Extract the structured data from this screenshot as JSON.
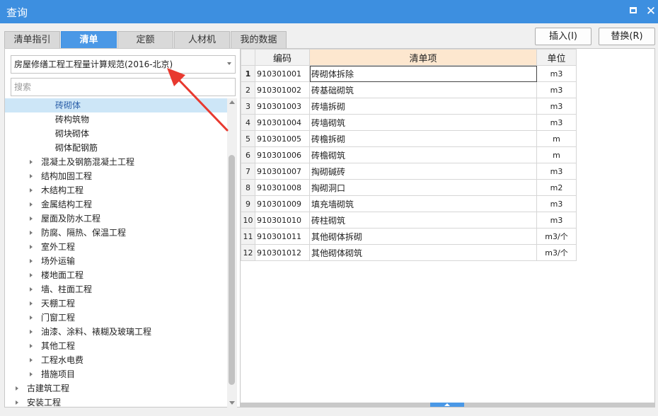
{
  "window": {
    "title": "查询"
  },
  "tabs": [
    {
      "label": "清单指引",
      "active": false
    },
    {
      "label": "清单",
      "active": true
    },
    {
      "label": "定额",
      "active": false
    },
    {
      "label": "人材机",
      "active": false
    },
    {
      "label": "我的数据",
      "active": false
    }
  ],
  "toolbar": {
    "insert_label": "插入(I)",
    "replace_label": "替换(R)"
  },
  "left": {
    "standard_selected": "房屋修缮工程工程量计算规范(2016-北京)",
    "search_placeholder": "搜索",
    "tree": [
      {
        "label": "砖砌体",
        "level": 3,
        "selected": true,
        "expandable": false
      },
      {
        "label": "砖构筑物",
        "level": 3,
        "selected": false,
        "expandable": false
      },
      {
        "label": "砌块砌体",
        "level": 3,
        "selected": false,
        "expandable": false
      },
      {
        "label": "砌体配钢筋",
        "level": 3,
        "selected": false,
        "expandable": false
      },
      {
        "label": "混凝土及钢筋混凝土工程",
        "level": 2,
        "selected": false,
        "expandable": true
      },
      {
        "label": "结构加固工程",
        "level": 2,
        "selected": false,
        "expandable": true
      },
      {
        "label": "木结构工程",
        "level": 2,
        "selected": false,
        "expandable": true
      },
      {
        "label": "金属结构工程",
        "level": 2,
        "selected": false,
        "expandable": true
      },
      {
        "label": "屋面及防水工程",
        "level": 2,
        "selected": false,
        "expandable": true
      },
      {
        "label": "防腐、隔热、保温工程",
        "level": 2,
        "selected": false,
        "expandable": true
      },
      {
        "label": "室外工程",
        "level": 2,
        "selected": false,
        "expandable": true
      },
      {
        "label": "场外运输",
        "level": 2,
        "selected": false,
        "expandable": true
      },
      {
        "label": "楼地面工程",
        "level": 2,
        "selected": false,
        "expandable": true
      },
      {
        "label": "墙、柱面工程",
        "level": 2,
        "selected": false,
        "expandable": true
      },
      {
        "label": "天棚工程",
        "level": 2,
        "selected": false,
        "expandable": true
      },
      {
        "label": "门窗工程",
        "level": 2,
        "selected": false,
        "expandable": true
      },
      {
        "label": "油漆、涂料、裱糊及玻璃工程",
        "level": 2,
        "selected": false,
        "expandable": true
      },
      {
        "label": "其他工程",
        "level": 2,
        "selected": false,
        "expandable": true
      },
      {
        "label": "工程水电费",
        "level": 2,
        "selected": false,
        "expandable": true
      },
      {
        "label": "措施项目",
        "level": 2,
        "selected": false,
        "expandable": true
      },
      {
        "label": "古建筑工程",
        "level": 1,
        "selected": false,
        "expandable": true
      },
      {
        "label": "安装工程",
        "level": 1,
        "selected": false,
        "expandable": true
      }
    ]
  },
  "table": {
    "columns": {
      "code": "编码",
      "name": "清单项",
      "unit": "单位"
    },
    "rows": [
      {
        "no": "1",
        "code": "910301001",
        "name": "砖砌体拆除",
        "unit": "m3",
        "active": true
      },
      {
        "no": "2",
        "code": "910301002",
        "name": "砖基础砌筑",
        "unit": "m3",
        "active": false
      },
      {
        "no": "3",
        "code": "910301003",
        "name": "砖墙拆砌",
        "unit": "m3",
        "active": false
      },
      {
        "no": "4",
        "code": "910301004",
        "name": "砖墙砌筑",
        "unit": "m3",
        "active": false
      },
      {
        "no": "5",
        "code": "910301005",
        "name": "砖檐拆砌",
        "unit": "m",
        "active": false
      },
      {
        "no": "6",
        "code": "910301006",
        "name": "砖檐砌筑",
        "unit": "m",
        "active": false
      },
      {
        "no": "7",
        "code": "910301007",
        "name": "掏砌碱砖",
        "unit": "m3",
        "active": false
      },
      {
        "no": "8",
        "code": "910301008",
        "name": "掏砌洞口",
        "unit": "m2",
        "active": false
      },
      {
        "no": "9",
        "code": "910301009",
        "name": "填充墙砌筑",
        "unit": "m3",
        "active": false
      },
      {
        "no": "10",
        "code": "910301010",
        "name": "砖柱砌筑",
        "unit": "m3",
        "active": false
      },
      {
        "no": "11",
        "code": "910301011",
        "name": "其他砌体拆砌",
        "unit": "m3/个",
        "active": false
      },
      {
        "no": "12",
        "code": "910301012",
        "name": "其他砌体砌筑",
        "unit": "m3/个",
        "active": false
      }
    ]
  },
  "colors": {
    "titlebar": "#3d8fe0",
    "active_tab": "#4a98e6",
    "selection": "#cde6f7",
    "header_highlight": "#fde7cf",
    "annotation_arrow": "#e8392f"
  },
  "icons": {
    "maximize": "maximize-icon",
    "close": "close-icon",
    "dropdown": "chevron-down-icon",
    "expand": "triangle-right-icon"
  }
}
